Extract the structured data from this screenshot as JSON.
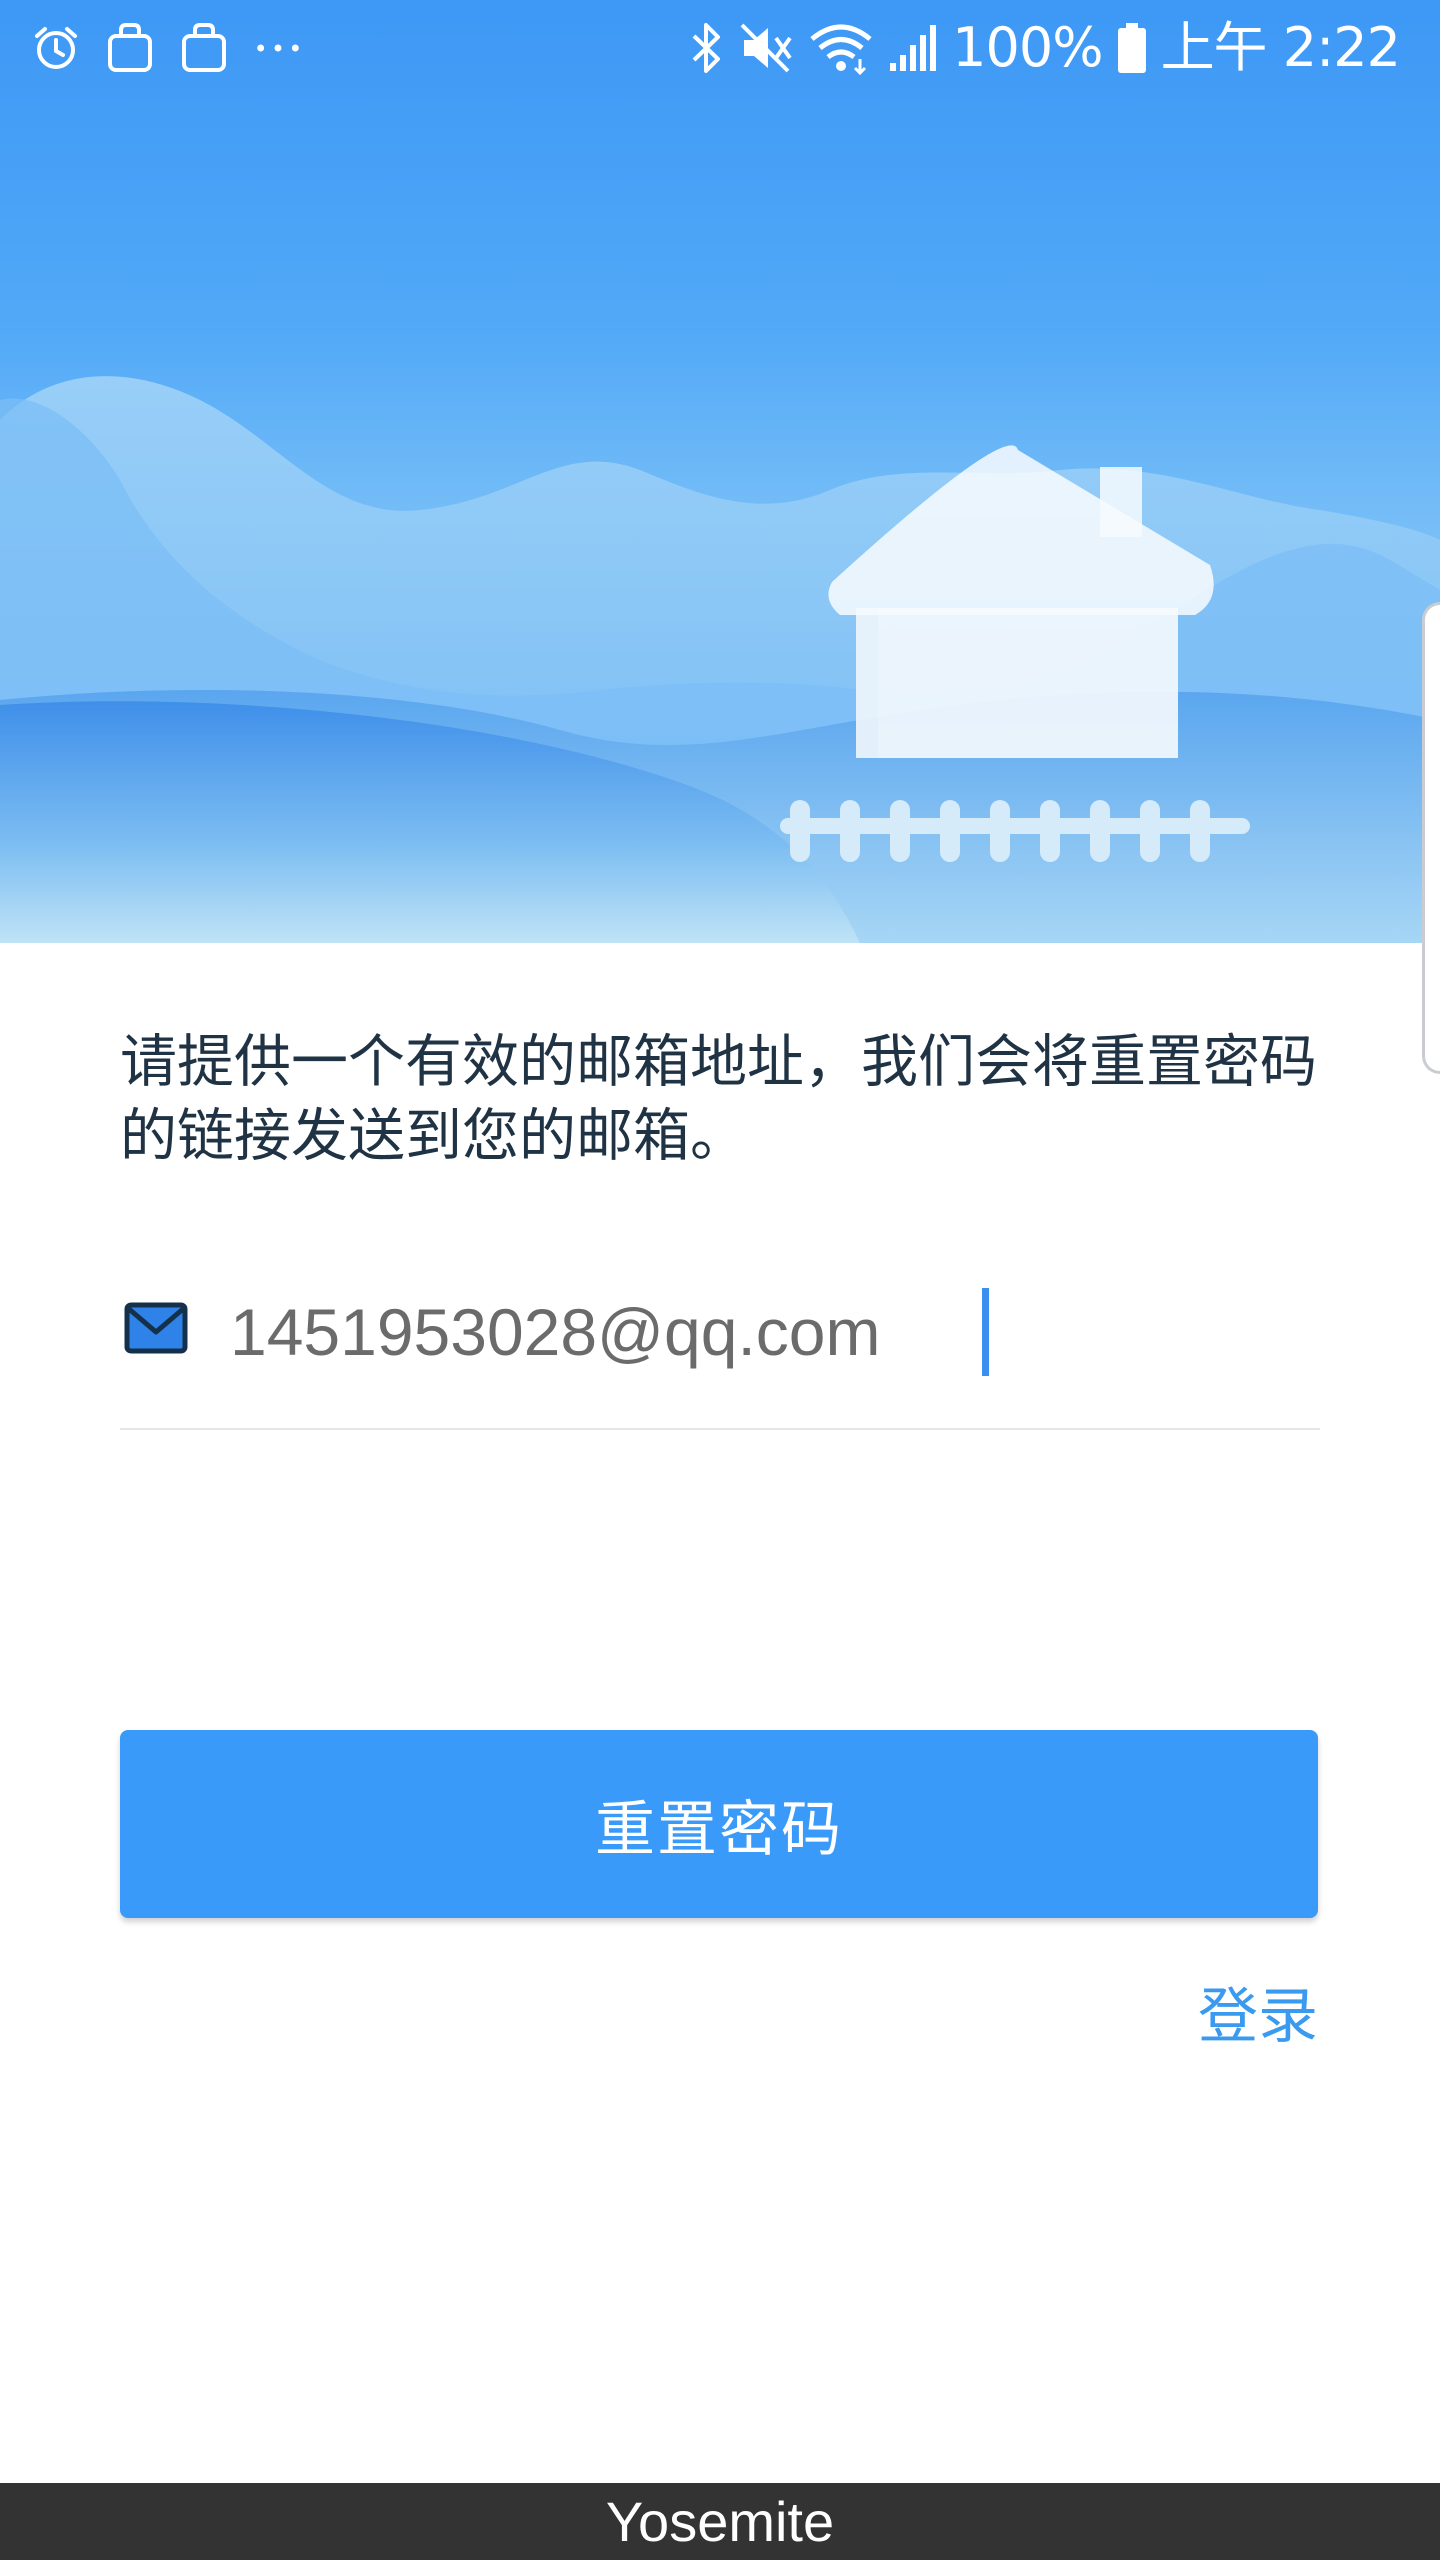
{
  "status_bar": {
    "battery_percent": "100%",
    "time": "上午 2:22",
    "icons_left": [
      "alarm-icon",
      "bag-icon",
      "bag-icon",
      "more-icon"
    ],
    "icons_right": [
      "bluetooth-icon",
      "mute-icon",
      "wifi-icon",
      "signal-icon",
      "battery-icon"
    ]
  },
  "hero": {
    "illustration": "house-on-hills-icon"
  },
  "form": {
    "instructions": "请提供一个有效的邮箱地址，我们会将重置密码的链接发送到您的邮箱。",
    "email_value": "1451953028@qq.com",
    "email_icon": "mail-icon",
    "reset_button_label": "重置密码",
    "login_link_label": "登录"
  },
  "caption": {
    "text": "Yosemite"
  },
  "colors": {
    "accent": "#3a9afa",
    "link": "#3a9af0",
    "hero_top": "#3d98f6",
    "text_dark": "#1f3344",
    "caption_bar": "#333333"
  }
}
